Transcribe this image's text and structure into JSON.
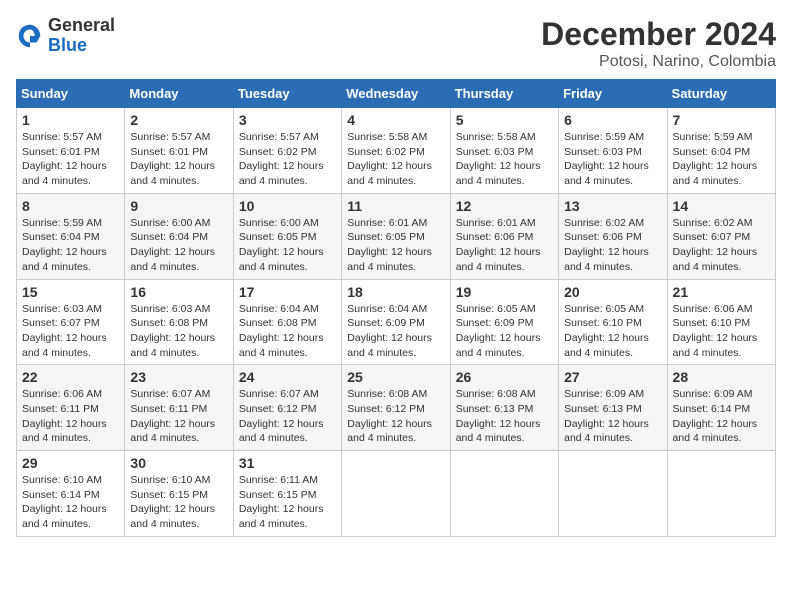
{
  "header": {
    "logo_general": "General",
    "logo_blue": "Blue",
    "month_title": "December 2024",
    "location": "Potosi, Narino, Colombia"
  },
  "days_of_week": [
    "Sunday",
    "Monday",
    "Tuesday",
    "Wednesday",
    "Thursday",
    "Friday",
    "Saturday"
  ],
  "weeks": [
    [
      {
        "day": "1",
        "sunrise": "5:57 AM",
        "sunset": "6:01 PM",
        "daylight": "12 hours and 4 minutes."
      },
      {
        "day": "2",
        "sunrise": "5:57 AM",
        "sunset": "6:01 PM",
        "daylight": "12 hours and 4 minutes."
      },
      {
        "day": "3",
        "sunrise": "5:57 AM",
        "sunset": "6:02 PM",
        "daylight": "12 hours and 4 minutes."
      },
      {
        "day": "4",
        "sunrise": "5:58 AM",
        "sunset": "6:02 PM",
        "daylight": "12 hours and 4 minutes."
      },
      {
        "day": "5",
        "sunrise": "5:58 AM",
        "sunset": "6:03 PM",
        "daylight": "12 hours and 4 minutes."
      },
      {
        "day": "6",
        "sunrise": "5:59 AM",
        "sunset": "6:03 PM",
        "daylight": "12 hours and 4 minutes."
      },
      {
        "day": "7",
        "sunrise": "5:59 AM",
        "sunset": "6:04 PM",
        "daylight": "12 hours and 4 minutes."
      }
    ],
    [
      {
        "day": "8",
        "sunrise": "5:59 AM",
        "sunset": "6:04 PM",
        "daylight": "12 hours and 4 minutes."
      },
      {
        "day": "9",
        "sunrise": "6:00 AM",
        "sunset": "6:04 PM",
        "daylight": "12 hours and 4 minutes."
      },
      {
        "day": "10",
        "sunrise": "6:00 AM",
        "sunset": "6:05 PM",
        "daylight": "12 hours and 4 minutes."
      },
      {
        "day": "11",
        "sunrise": "6:01 AM",
        "sunset": "6:05 PM",
        "daylight": "12 hours and 4 minutes."
      },
      {
        "day": "12",
        "sunrise": "6:01 AM",
        "sunset": "6:06 PM",
        "daylight": "12 hours and 4 minutes."
      },
      {
        "day": "13",
        "sunrise": "6:02 AM",
        "sunset": "6:06 PM",
        "daylight": "12 hours and 4 minutes."
      },
      {
        "day": "14",
        "sunrise": "6:02 AM",
        "sunset": "6:07 PM",
        "daylight": "12 hours and 4 minutes."
      }
    ],
    [
      {
        "day": "15",
        "sunrise": "6:03 AM",
        "sunset": "6:07 PM",
        "daylight": "12 hours and 4 minutes."
      },
      {
        "day": "16",
        "sunrise": "6:03 AM",
        "sunset": "6:08 PM",
        "daylight": "12 hours and 4 minutes."
      },
      {
        "day": "17",
        "sunrise": "6:04 AM",
        "sunset": "6:08 PM",
        "daylight": "12 hours and 4 minutes."
      },
      {
        "day": "18",
        "sunrise": "6:04 AM",
        "sunset": "6:09 PM",
        "daylight": "12 hours and 4 minutes."
      },
      {
        "day": "19",
        "sunrise": "6:05 AM",
        "sunset": "6:09 PM",
        "daylight": "12 hours and 4 minutes."
      },
      {
        "day": "20",
        "sunrise": "6:05 AM",
        "sunset": "6:10 PM",
        "daylight": "12 hours and 4 minutes."
      },
      {
        "day": "21",
        "sunrise": "6:06 AM",
        "sunset": "6:10 PM",
        "daylight": "12 hours and 4 minutes."
      }
    ],
    [
      {
        "day": "22",
        "sunrise": "6:06 AM",
        "sunset": "6:11 PM",
        "daylight": "12 hours and 4 minutes."
      },
      {
        "day": "23",
        "sunrise": "6:07 AM",
        "sunset": "6:11 PM",
        "daylight": "12 hours and 4 minutes."
      },
      {
        "day": "24",
        "sunrise": "6:07 AM",
        "sunset": "6:12 PM",
        "daylight": "12 hours and 4 minutes."
      },
      {
        "day": "25",
        "sunrise": "6:08 AM",
        "sunset": "6:12 PM",
        "daylight": "12 hours and 4 minutes."
      },
      {
        "day": "26",
        "sunrise": "6:08 AM",
        "sunset": "6:13 PM",
        "daylight": "12 hours and 4 minutes."
      },
      {
        "day": "27",
        "sunrise": "6:09 AM",
        "sunset": "6:13 PM",
        "daylight": "12 hours and 4 minutes."
      },
      {
        "day": "28",
        "sunrise": "6:09 AM",
        "sunset": "6:14 PM",
        "daylight": "12 hours and 4 minutes."
      }
    ],
    [
      {
        "day": "29",
        "sunrise": "6:10 AM",
        "sunset": "6:14 PM",
        "daylight": "12 hours and 4 minutes."
      },
      {
        "day": "30",
        "sunrise": "6:10 AM",
        "sunset": "6:15 PM",
        "daylight": "12 hours and 4 minutes."
      },
      {
        "day": "31",
        "sunrise": "6:11 AM",
        "sunset": "6:15 PM",
        "daylight": "12 hours and 4 minutes."
      },
      null,
      null,
      null,
      null
    ]
  ]
}
